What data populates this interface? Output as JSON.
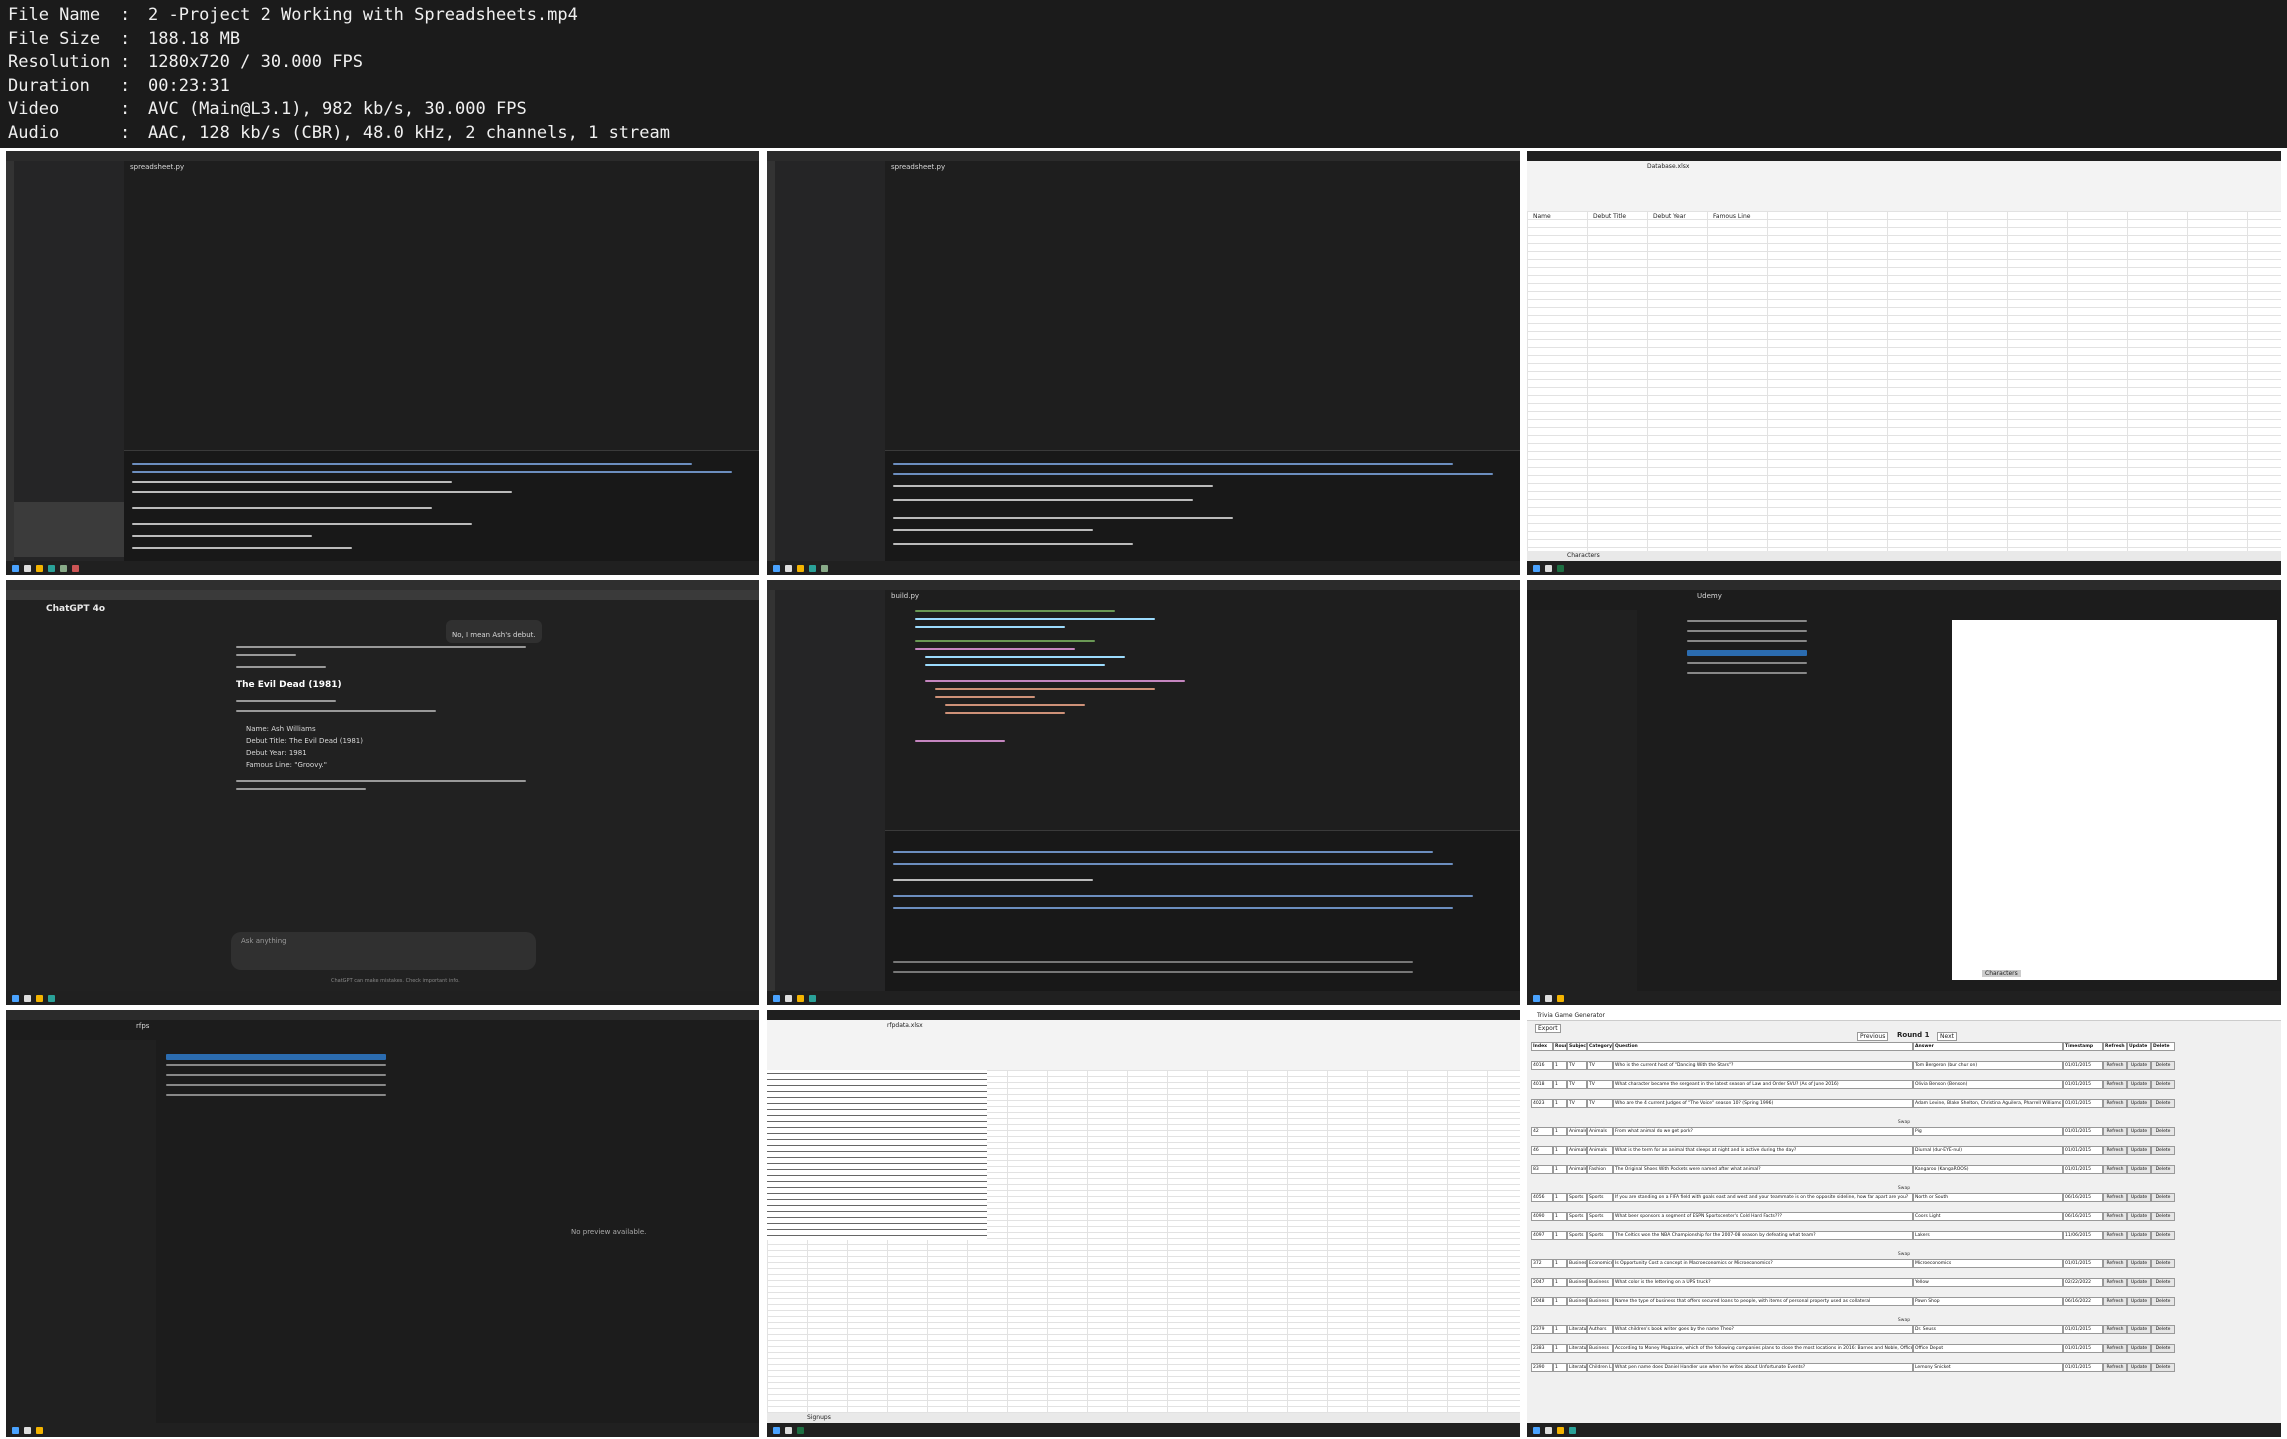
{
  "media_info": {
    "rows": [
      {
        "key": "File Name",
        "value": "2 -Project 2 Working with Spreadsheets.mp4"
      },
      {
        "key": "File Size",
        "value": "188.18 MB"
      },
      {
        "key": "Resolution",
        "value": "1280x720 / 30.000 FPS"
      },
      {
        "key": "Duration",
        "value": "00:23:31"
      },
      {
        "key": "Video",
        "value": "AVC (Main@L3.1), 982 kb/s, 30.000 FPS"
      },
      {
        "key": "Audio",
        "value": "AAC, 128 kb/s (CBR), 48.0 kHz, 2 channels, 1 stream"
      }
    ]
  },
  "thumbnails": {
    "t1": {
      "tab": "spreadsheet.py",
      "file": "spreadsheet.py"
    },
    "t2": {
      "tab": "spreadsheet.py"
    },
    "t3": {
      "sheet_tab": "Characters",
      "title": "Database.xlsx",
      "headers": [
        "Name",
        "Debut Title",
        "Debut Year",
        "Famous Line"
      ]
    },
    "t4": {
      "brand": "ChatGPT 4o",
      "heading": "The Evil Dead (1981)",
      "user_msg": "No, I mean Ash's debut.",
      "bullets": [
        "Name: Ash Williams",
        "Debut Title: The Evil Dead (1981)",
        "Debut Year: 1981",
        "Famous Line: \"Groovy.\""
      ],
      "input_placeholder": "Ask anything",
      "footer": "ChatGPT can make mistakes. Check important info."
    },
    "t5": {
      "tab": "build.py"
    },
    "t6": {
      "path": "Udemy",
      "sheet_tab": "Characters"
    },
    "t7": {
      "path": "rfps",
      "preview": "No preview available."
    },
    "t8": {
      "title": "rfpdata.xlsx",
      "sheet_tab": "Signups"
    },
    "t9": {
      "app_title": "Trivia Game Generator",
      "round": "Round 1",
      "prev": "Previous",
      "next": "Next",
      "export": "Export",
      "headers": [
        "Index",
        "Round",
        "Subject",
        "Category",
        "Question",
        "Answer",
        "Timestamp",
        "Refresh",
        "Update",
        "Delete"
      ],
      "rows": [
        {
          "index": "4016",
          "round": "1",
          "subject": "TV",
          "category": "TV",
          "question": "Who is the current host of \"Dancing With the Stars\"?",
          "answer": "Tom Bergeron (bur chur on)",
          "ts": "01/01/2015"
        },
        {
          "index": "4018",
          "round": "1",
          "subject": "TV",
          "category": "TV",
          "question": "What character became the sergeant in the latest season of Law and Order SVU? (As of June 2016)",
          "answer": "Olivia Benson (Benson)",
          "ts": "01/01/2015"
        },
        {
          "index": "4023",
          "round": "1",
          "subject": "TV",
          "category": "TV",
          "question": "Who are the 4 current Judges of \"The Voice\" season 10? (Spring 1996)",
          "answer": "Adam Levine, Blake Shelton, Christina Aguilera, Pharrell Williams",
          "ts": "01/01/2015"
        },
        {
          "index": "42",
          "round": "1",
          "subject": "Animals",
          "category": "Animals",
          "question": "From what animal do we get pork?",
          "answer": "Pig",
          "ts": "01/01/2015"
        },
        {
          "index": "46",
          "round": "1",
          "subject": "Animals",
          "category": "Animals",
          "question": "What is the term for an animal that sleeps at night and is active during the day?",
          "answer": "Diurnal (dur-EYE-nul)",
          "ts": "01/01/2015"
        },
        {
          "index": "83",
          "round": "1",
          "subject": "Animals",
          "category": "Fashion",
          "question": "The Original Shoes With Pockets were named after what animal?",
          "answer": "Kangaroo (KangaROOS)",
          "ts": "01/01/2015"
        },
        {
          "index": "4056",
          "round": "1",
          "subject": "Sports",
          "category": "Sports",
          "question": "If you are standing on a FIFA field with goals east and west and your teammate is on the opposite sideline, how far apart are you?",
          "answer": "North or South",
          "ts": "06/16/2015"
        },
        {
          "index": "4090",
          "round": "1",
          "subject": "Sports",
          "category": "Sports",
          "question": "What beer sponsors a segment of ESPN Sportscenter's Cold Hard Facts???",
          "answer": "Coors Light",
          "ts": "06/16/2015"
        },
        {
          "index": "4097",
          "round": "1",
          "subject": "Sports",
          "category": "Sports",
          "question": "The Celtics won the NBA Championship for the 2007-08 season by defeating what team?",
          "answer": "Lakers",
          "ts": "11/06/2015"
        },
        {
          "index": "372",
          "round": "1",
          "subject": "Business",
          "category": "Economics",
          "question": "Is Opportunity Cost a concept in Macroeconomics or Microeconomics?",
          "answer": "Microeconomics",
          "ts": "01/01/2015"
        },
        {
          "index": "2047",
          "round": "1",
          "subject": "Business",
          "category": "Business",
          "question": "What color is the lettering on a UPS truck?",
          "answer": "Yellow",
          "ts": "02/22/2022"
        },
        {
          "index": "2048",
          "round": "1",
          "subject": "Business",
          "category": "Business",
          "question": "Name the type of business that offers secured loans to people, with items of personal property used as collateral",
          "answer": "Pawn Shop",
          "ts": "06/16/2022"
        },
        {
          "index": "2379",
          "round": "1",
          "subject": "Literature",
          "category": "Authors",
          "question": "What children's book writer goes by the name Theo?",
          "answer": "Dr. Seuss",
          "ts": "01/01/2015"
        },
        {
          "index": "2383",
          "round": "1",
          "subject": "Literature",
          "category": "Business",
          "question": "According to Money Magazine, which of the following companies plans to close the most locations in 2016: Barnes and Noble, Office Depot, Abercrombie and Fitch, or Sears?",
          "answer": "Office Depot",
          "ts": "01/01/2015"
        },
        {
          "index": "2390",
          "round": "1",
          "subject": "Literature",
          "category": "Children Lit",
          "question": "What pen name does Daniel Handler use when he writes about Unfortunate Events?",
          "answer": "Lemony Snicket",
          "ts": "01/01/2015"
        }
      ],
      "group_label": "Swap",
      "btn_refresh": "Refresh",
      "btn_update": "Update",
      "btn_delete": "Delete"
    }
  }
}
